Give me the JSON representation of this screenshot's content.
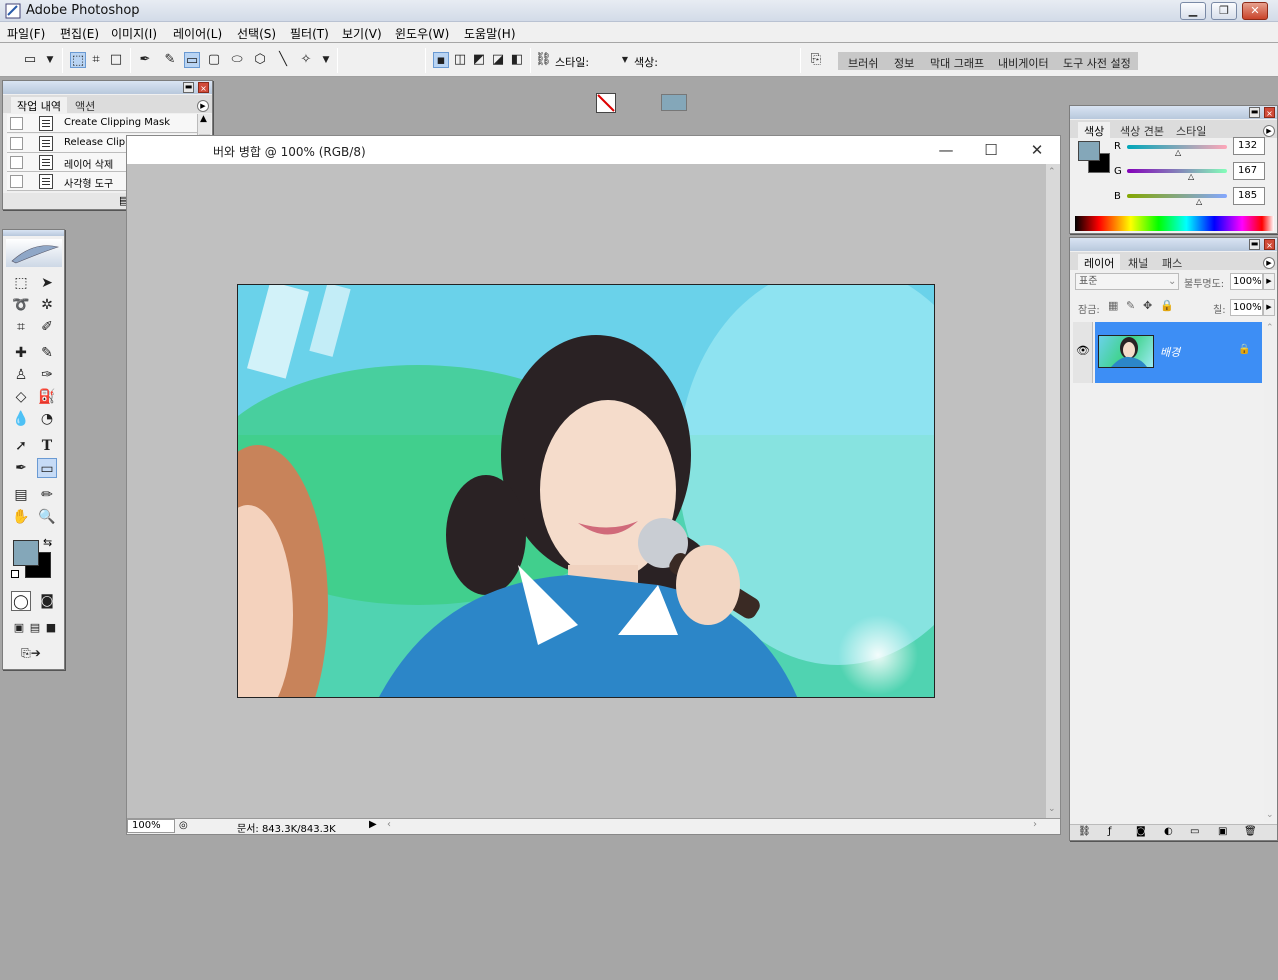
{
  "app": {
    "title": "Adobe Photoshop"
  },
  "menus": [
    "파일(F)",
    "편집(E)",
    "이미지(I)",
    "레이어(L)",
    "선택(S)",
    "필터(T)",
    "보기(V)",
    "윈도우(W)",
    "도움말(H)"
  ],
  "options_bar": {
    "style_label": "스타일:",
    "color_label": "색상:",
    "color_swatch": "#84a7b9"
  },
  "palette_well": {
    "tabs": [
      "브러쉬",
      "정보",
      "막대 그래프",
      "내비게이터",
      "도구 사전 설정"
    ]
  },
  "history_palette": {
    "tabs": [
      "작업 내역",
      "액션"
    ],
    "items": [
      "Create Clipping Mask",
      "Release Clipping Mask",
      "레이어 삭제",
      "사각형 도구"
    ]
  },
  "document": {
    "title": "버와 병합 @ 100% (RGB/8)",
    "zoom": "100%",
    "doc_size": "문서: 843.3K/843.3K"
  },
  "color_palette": {
    "tabs": [
      "색상",
      "색상 견본",
      "스타일"
    ],
    "channels": [
      {
        "label": "R",
        "value": "132"
      },
      {
        "label": "G",
        "value": "167"
      },
      {
        "label": "B",
        "value": "185"
      }
    ],
    "foreground": "#84a7b9",
    "background": "#000000"
  },
  "layers_palette": {
    "tabs": [
      "레이어",
      "채널",
      "패스"
    ],
    "blend_mode": "표준",
    "opacity_label": "불투명도:",
    "opacity": "100%",
    "lock_label": "잠금:",
    "fill_label": "칠:",
    "fill": "100%",
    "layer_name": "배경",
    "selection_color": "#3d8ef5"
  }
}
